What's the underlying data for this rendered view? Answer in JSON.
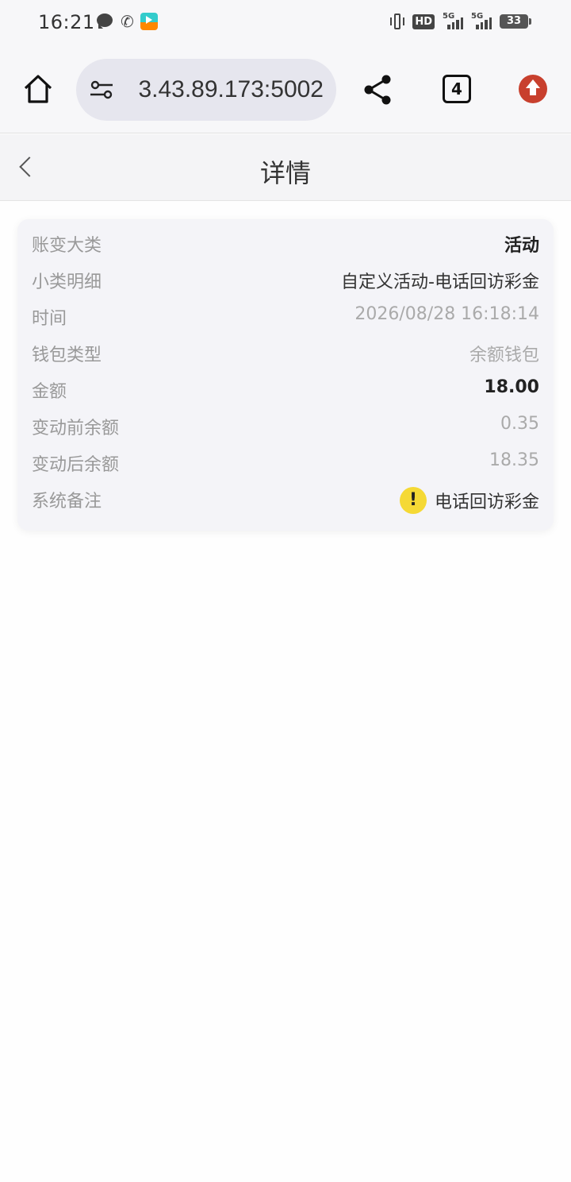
{
  "status_bar": {
    "time": "16:21",
    "battery": "33",
    "signal_labels": [
      "5G",
      "5G"
    ],
    "hd_label": "HD"
  },
  "browser": {
    "url": "3.43.89.173:5002",
    "tab_count": "4"
  },
  "header": {
    "title": "详情"
  },
  "details": [
    {
      "label": "账变大类",
      "value": "活动"
    },
    {
      "label": "小类明细",
      "value": "自定义活动-电话回访彩金"
    },
    {
      "label": "时间",
      "value": "2026/08/28 16:18:14"
    },
    {
      "label": "钱包类型",
      "value": "余额钱包"
    },
    {
      "label": "金额",
      "value": "18.00"
    },
    {
      "label": "变动前余额",
      "value": "0.35"
    },
    {
      "label": "变动后余额",
      "value": "18.35"
    },
    {
      "label": "系统备注",
      "value": "电话回访彩金"
    }
  ],
  "warning_glyph": "!"
}
